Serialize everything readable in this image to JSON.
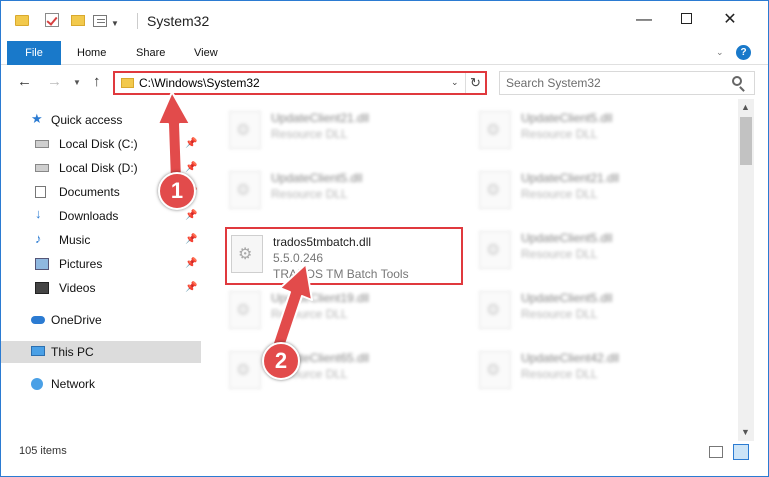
{
  "window": {
    "title": "System32"
  },
  "ribbon": {
    "tabs": [
      "File",
      "Home",
      "Share",
      "View"
    ],
    "help": "?"
  },
  "navigation": {
    "address": "C:\\Windows\\System32",
    "search_placeholder": "Search System32"
  },
  "sidebar": {
    "items": [
      {
        "label": "Quick access",
        "icon": "star-icon",
        "pinned": false
      },
      {
        "label": "Local Disk (C:)",
        "icon": "drive-icon",
        "pinned": true
      },
      {
        "label": "Local Disk (D:)",
        "icon": "drive-icon",
        "pinned": true
      },
      {
        "label": "Documents",
        "icon": "documents-icon",
        "pinned": true
      },
      {
        "label": "Downloads",
        "icon": "download-icon",
        "pinned": true
      },
      {
        "label": "Music",
        "icon": "music-icon",
        "pinned": true
      },
      {
        "label": "Pictures",
        "icon": "pictures-icon",
        "pinned": true
      },
      {
        "label": "Videos",
        "icon": "videos-icon",
        "pinned": true
      },
      {
        "label": "OneDrive",
        "icon": "cloud-icon",
        "pinned": false
      },
      {
        "label": "This PC",
        "icon": "pc-icon",
        "pinned": false,
        "selected": true
      },
      {
        "label": "Network",
        "icon": "network-icon",
        "pinned": false
      }
    ]
  },
  "files": {
    "left": [
      {
        "name": "UpdateClient21.dll",
        "type": "Resource DLL"
      },
      {
        "name": "UpdateClient5.dll",
        "type": "Resource DLL"
      },
      {
        "name": "UpdateClient19.dll",
        "type": "Resource DLL"
      },
      {
        "name": "UpdateClient65.dll",
        "type": "Resource DLL"
      }
    ],
    "right": [
      {
        "name": "UpdateClient5.dll",
        "type": "Resource DLL"
      },
      {
        "name": "UpdateClient21.dll",
        "type": "Resource DLL"
      },
      {
        "name": "UpdateClient5.dll",
        "type": "Resource DLL"
      },
      {
        "name": "UpdateClient5.dll",
        "type": "Resource DLL"
      },
      {
        "name": "UpdateClient42.dll",
        "type": "Resource DLL"
      }
    ],
    "highlighted": {
      "name": "trados5tmbatch.dll",
      "version": "5.5.0.246",
      "description": "TRADOS TM Batch Tools"
    }
  },
  "status": {
    "count": "105 items"
  },
  "annotations": {
    "badge1": "1",
    "badge2": "2"
  },
  "colors": {
    "accent": "#1979ca",
    "highlight": "#e0393e",
    "badge": "#e24b4b"
  }
}
